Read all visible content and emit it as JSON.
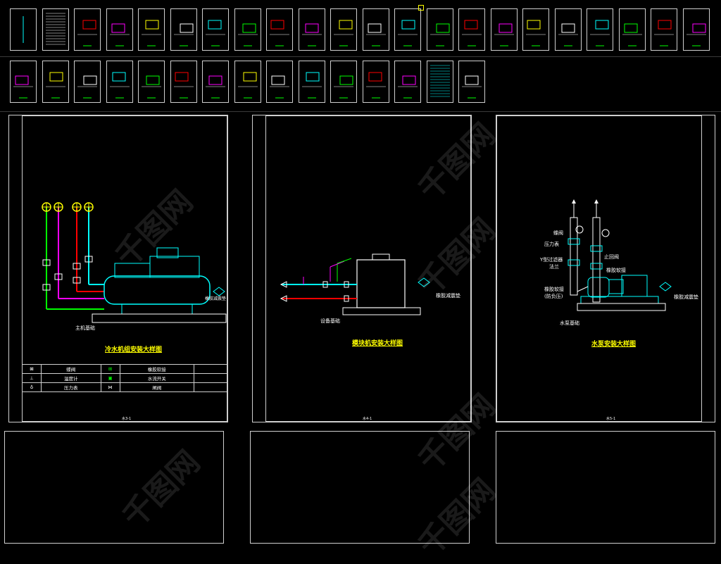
{
  "thumbnails_row1": [
    {
      "icon": "title-sheet-icon"
    },
    {
      "icon": "table-sheet-icon"
    },
    {
      "icon": "drawing-icon"
    },
    {
      "icon": "drawing-icon"
    },
    {
      "icon": "drawing-icon"
    },
    {
      "icon": "drawing-icon"
    },
    {
      "icon": "drawing-icon"
    },
    {
      "icon": "drawing-icon"
    },
    {
      "icon": "drawing-icon"
    },
    {
      "icon": "drawing-icon"
    },
    {
      "icon": "drawing-icon"
    },
    {
      "icon": "drawing-icon"
    },
    {
      "icon": "drawing-icon"
    },
    {
      "icon": "drawing-icon"
    },
    {
      "icon": "drawing-icon"
    },
    {
      "icon": "drawing-icon"
    },
    {
      "icon": "drawing-icon"
    },
    {
      "icon": "drawing-icon"
    },
    {
      "icon": "drawing-icon"
    },
    {
      "icon": "drawing-icon"
    },
    {
      "icon": "drawing-icon"
    },
    {
      "icon": "drawing-icon"
    }
  ],
  "thumbnails_row2": [
    {
      "icon": "drawing-icon"
    },
    {
      "icon": "drawing-icon"
    },
    {
      "icon": "drawing-icon"
    },
    {
      "icon": "drawing-icon"
    },
    {
      "icon": "drawing-icon"
    },
    {
      "icon": "drawing-icon"
    },
    {
      "icon": "drawing-icon"
    },
    {
      "icon": "drawing-icon"
    },
    {
      "icon": "drawing-icon"
    },
    {
      "icon": "drawing-icon"
    },
    {
      "icon": "drawing-icon"
    },
    {
      "icon": "drawing-icon"
    },
    {
      "icon": "drawing-icon"
    },
    {
      "icon": "table-sheet-icon"
    },
    {
      "icon": "drawing-icon"
    }
  ],
  "sheet1": {
    "title": "冷水机组安装大样图",
    "number": "水3-1",
    "base_label": "主机基础",
    "damper_label": "橡胶减震垫",
    "legend": [
      [
        "蝶阀",
        "橡胶软接"
      ],
      [
        "温度计",
        "水流开关"
      ],
      [
        "压力表",
        "闸阀"
      ]
    ]
  },
  "sheet2": {
    "title": "模块机安装大样图",
    "number": "水4-1",
    "base_label": "设备基础",
    "damper_label": "橡胶减震垫"
  },
  "sheet3": {
    "title": "水泵安装大样图",
    "number": "水5-1",
    "labels": {
      "valve": "蝶阀",
      "gauge": "压力表",
      "filter": "Y型过滤器",
      "flange": "法兰",
      "check_valve": "止回阀",
      "soft_joint_top": "橡胶软接",
      "soft_joint_bottom": "橡胶软接",
      "anti_pressure": "(防负压)",
      "base": "水泵基础",
      "damper": "橡胶减震垫"
    }
  },
  "watermark": "千图网",
  "colors": {
    "background": "#000000",
    "frame": "#cfcfcf",
    "green": "#00ff00",
    "cyan": "#00ffff",
    "red": "#ff0000",
    "magenta": "#ff00ff",
    "yellow": "#ffff00"
  }
}
